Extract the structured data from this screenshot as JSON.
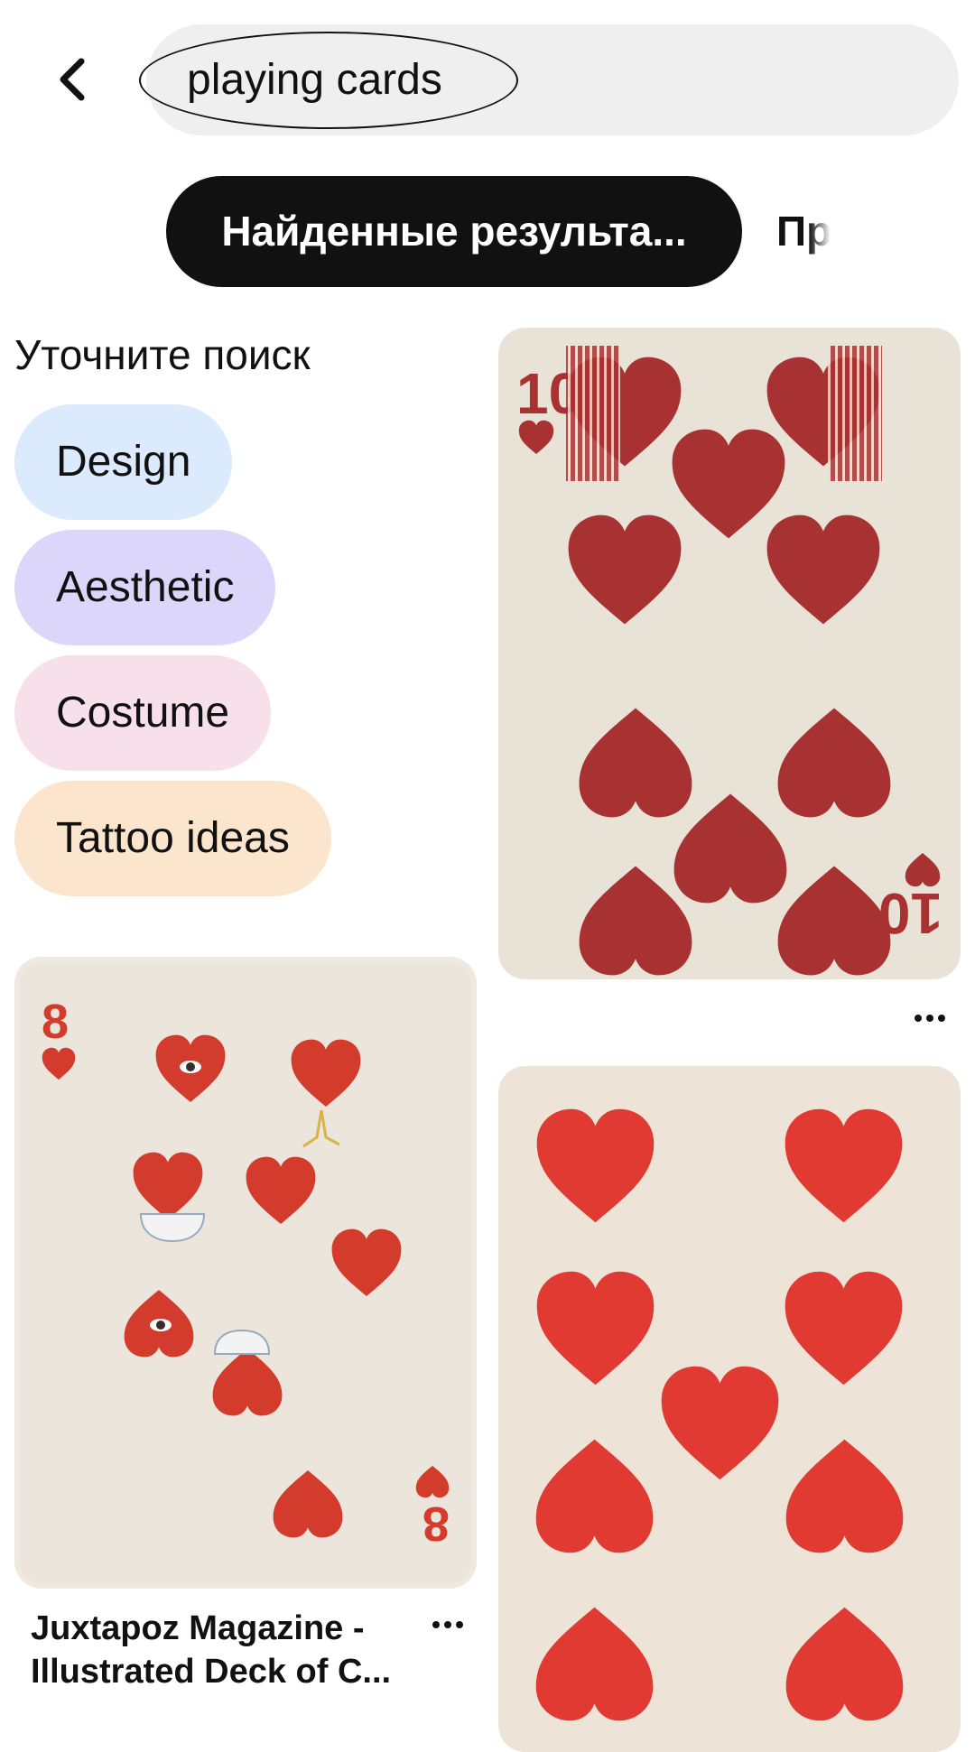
{
  "search": {
    "query": "playing cards"
  },
  "tabs": [
    {
      "label": "Найденные результа..."
    },
    {
      "label": "Пр"
    }
  ],
  "refine": {
    "heading": "Уточните поиск",
    "chips": [
      {
        "label": "Design",
        "color": "#dbeafc"
      },
      {
        "label": "Aesthetic",
        "color": "#dcd6fb"
      },
      {
        "label": "Costume",
        "color": "#f8e0ea"
      },
      {
        "label": "Tattoo ideas",
        "color": "#fbe6cd"
      }
    ]
  },
  "pins": [
    {
      "title": "",
      "card_rank": "10",
      "suit": "hearts",
      "style": "vintage-striped",
      "color": "#a83232"
    },
    {
      "title": "Juxtapoz Magazine - Illustrated Deck of C...",
      "card_rank": "8",
      "suit": "hearts",
      "style": "illustrated-surreal",
      "color": "#d33b2c"
    },
    {
      "title": "",
      "card_rank": "",
      "suit": "hearts",
      "style": "antique",
      "color": "#e03a33"
    }
  ],
  "icons": {
    "back": "chevron-left-icon",
    "more": "more-horizontal-icon"
  }
}
